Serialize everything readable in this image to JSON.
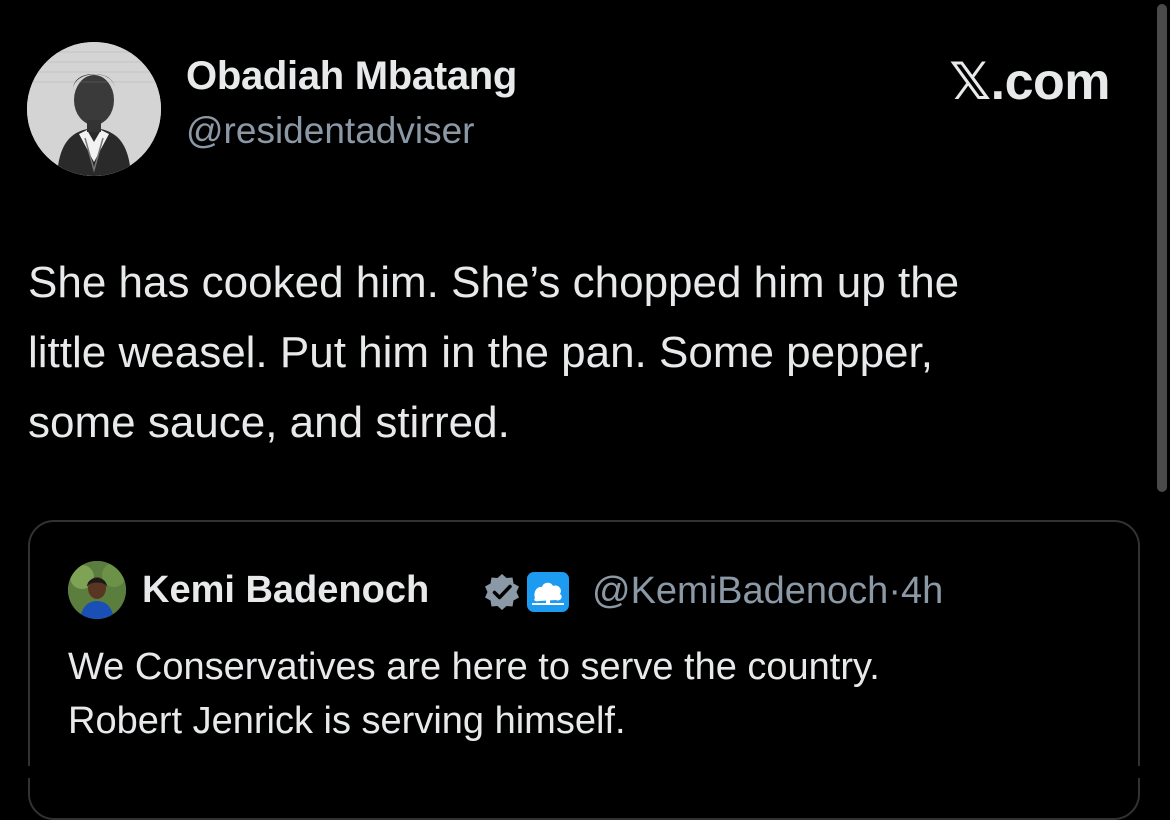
{
  "tweet": {
    "author_name": "Obadiah Mbatang",
    "author_handle": "@residentadviser",
    "brand": {
      "prefix": "𝕏",
      "suffix": ".com"
    },
    "body_lines": [
      "She has cooked him. She’s chopped him up the",
      "little weasel. Put him in the pan. Some pepper,",
      "some sauce, and stirred."
    ]
  },
  "quote": {
    "author_name": "Kemi Badenoch",
    "handle": "@KemiBadenoch",
    "separator": "·",
    "time": "4h",
    "body_lines": [
      "We Conservatives are here to serve the country.",
      "Robert Jenrick is serving himself."
    ],
    "verified_color": "#8b98a5",
    "affiliate_color": "#1d9bf0"
  },
  "colors": {
    "background": "#000000",
    "text": "#e7e9ea",
    "secondary_text": "#8b98a5",
    "border": "#2f3336"
  }
}
